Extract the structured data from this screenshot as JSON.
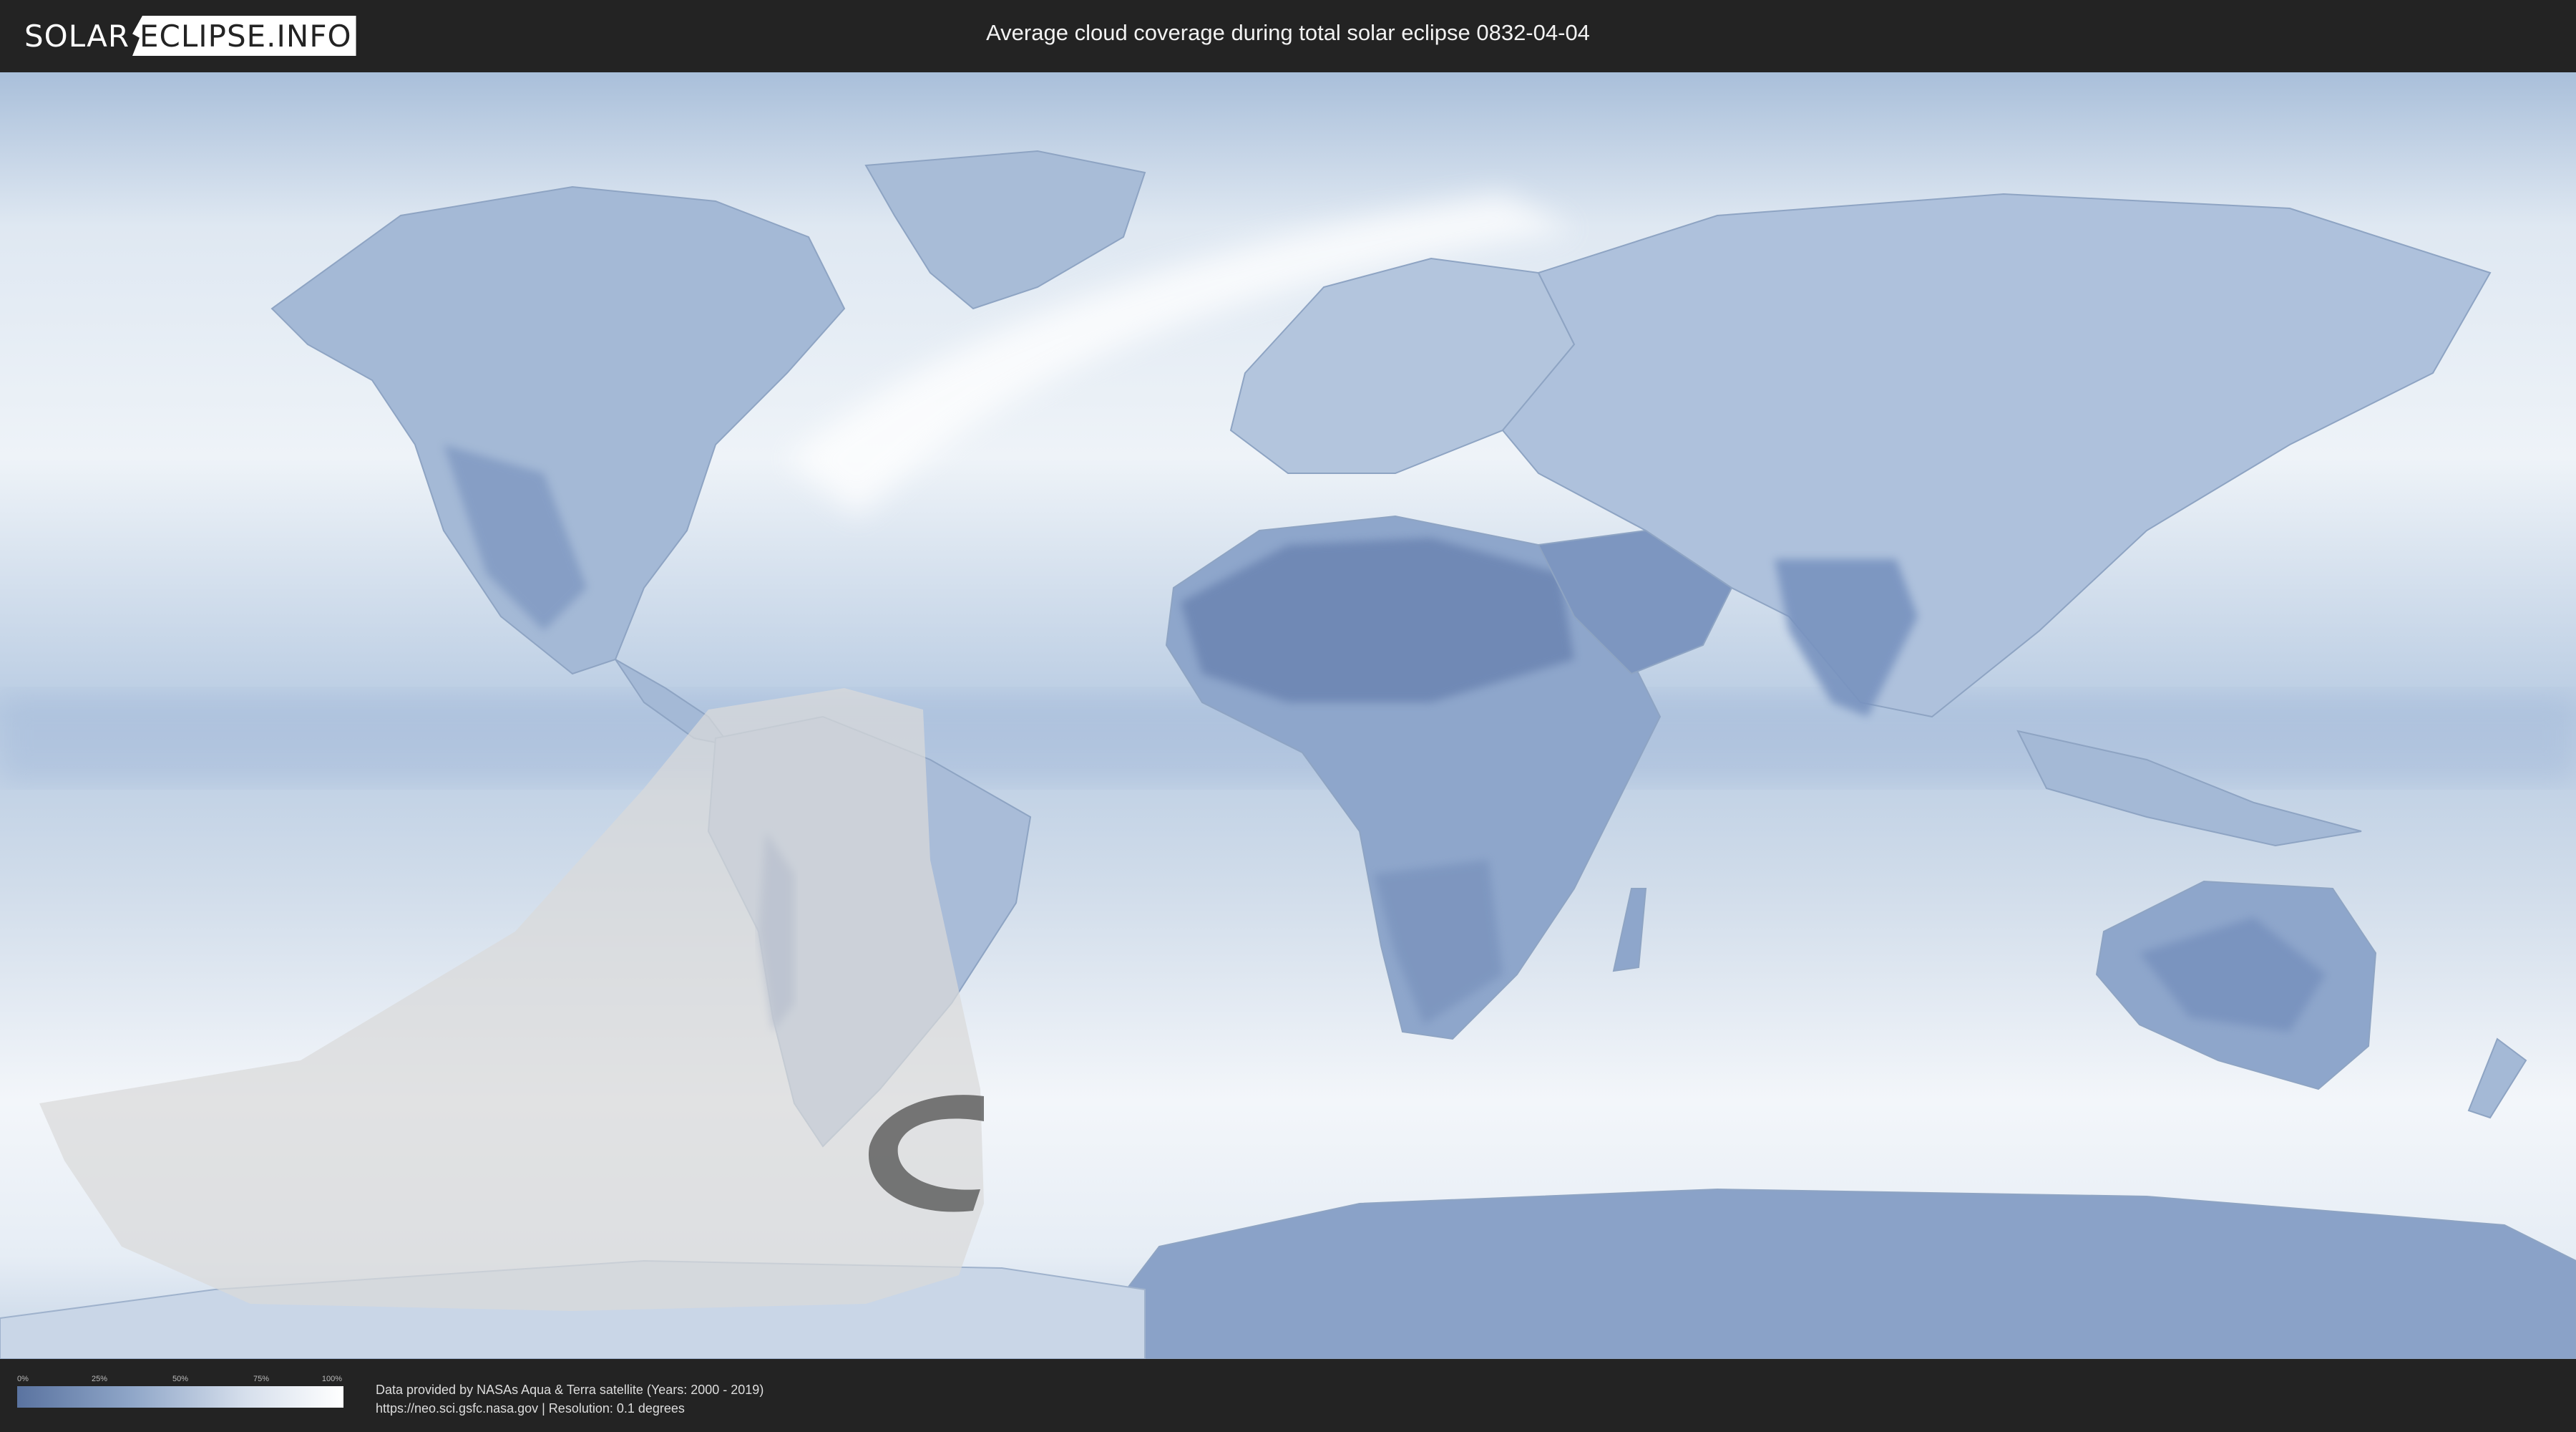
{
  "header": {
    "logo_left": "SOLAR",
    "logo_right": "ECLIPSE.INFO",
    "title": "Average cloud coverage during total solar eclipse 0832-04-04"
  },
  "legend": {
    "ticks": [
      "0%",
      "25%",
      "50%",
      "75%",
      "100%"
    ],
    "gradient": [
      "#5a73a0",
      "#8fa6c8",
      "#d6dfec",
      "#ffffff"
    ]
  },
  "footer": {
    "credit_line1": "Data provided by NASAs Aqua & Terra satellite (Years: 2000 - 2019)",
    "credit_line2": "https://neo.sci.gsfc.nasa.gov | Resolution: 0.1 degrees"
  },
  "map": {
    "ocean_color": "#c3d3e6",
    "land_low_cloud_color": "#7a93bd",
    "overlay_color": "#d9d9d9"
  }
}
